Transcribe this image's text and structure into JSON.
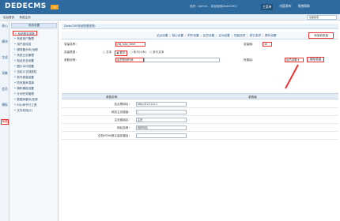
{
  "app": {
    "logo": "DEDECMS",
    "logo_version": "v5",
    "welcome": "您好：admin ，欢迎使用DedeCMS！",
    "top_nav": [
      "主菜单",
      "内容发布",
      "系统帮助"
    ],
    "sub_links": [
      "后台首页",
      "系统主页"
    ],
    "search_placeholder": "功能搜索"
  },
  "left_tabs": [
    {
      "label": "核心",
      "selected": false
    },
    {
      "label": "模块",
      "selected": false
    },
    {
      "label": "生成",
      "selected": false
    },
    {
      "label": "采集",
      "selected": false
    },
    {
      "label": "会员",
      "selected": false
    },
    {
      "label": "模板",
      "selected": false
    },
    {
      "label": "系统",
      "selected": true
    }
  ],
  "sidebar": {
    "header": "系统设置",
    "items": [
      {
        "label": "系统基本参数",
        "selected": true
      },
      {
        "label": "系统用户管理",
        "selected": false
      },
      {
        "label": "用户组设定",
        "selected": false
      },
      {
        "label": "服务器分布/远程",
        "selected": false
      },
      {
        "label": "系统日志管理",
        "selected": false
      },
      {
        "label": "验证安全设置",
        "selected": false
      },
      {
        "label": "图片水印设置",
        "selected": false
      },
      {
        "label": "自定义文档属性",
        "selected": false
      },
      {
        "label": "软件频道设置",
        "selected": false
      },
      {
        "label": "防采集串混淆",
        "selected": false
      },
      {
        "label": "随机模板设置",
        "selected": false
      },
      {
        "label": "计划任务管理",
        "selected": false
      },
      {
        "label": "数据库备份/还原",
        "selected": false
      },
      {
        "label": "SQL命令行工具",
        "selected": false
      },
      {
        "label": "文件校验[S]",
        "selected": false
      }
    ]
  },
  "main": {
    "breadcrumb": "DedeCMS系统配置参数：",
    "tabs": [
      "站点设置",
      "核心设置",
      "附件设置",
      "会员设置",
      "互动设置",
      "性能选项",
      "其它选项",
      "模块设置"
    ],
    "add_var_button": "添加新变量",
    "form": {
      "var_name_label": "变量名称：",
      "var_name_value": "cfg_sign_time",
      "var_value_label": "变量值：",
      "var_value_value": "10",
      "var_type_label": "变量类型：",
      "var_type_options": [
        "文本",
        "数字",
        "布尔(Y/N)",
        "多行文本"
      ],
      "var_type_selected": 1,
      "param_desc_label": "参数说明：",
      "param_desc_value": "会员签到时间",
      "group_label": "所属组：",
      "group_value": "会员设置",
      "save_button": "保存变量"
    },
    "table": {
      "headers": [
        "参数说明",
        "参数值"
      ],
      "rows": [
        {
          "label": "站点根网址：",
          "value": "http://127.0.0.1"
        },
        {
          "label": "网页主页链接：",
          "value": "/"
        },
        {
          "label": "主页链接名：",
          "value": "主页"
        },
        {
          "label": "网站名称：",
          "value": "我的网站"
        },
        {
          "label": "文档HTML默认保存路径：",
          "value": ""
        }
      ]
    }
  },
  "colors": {
    "topbar": "#2f6a9e",
    "highlight": "#ee3333"
  }
}
